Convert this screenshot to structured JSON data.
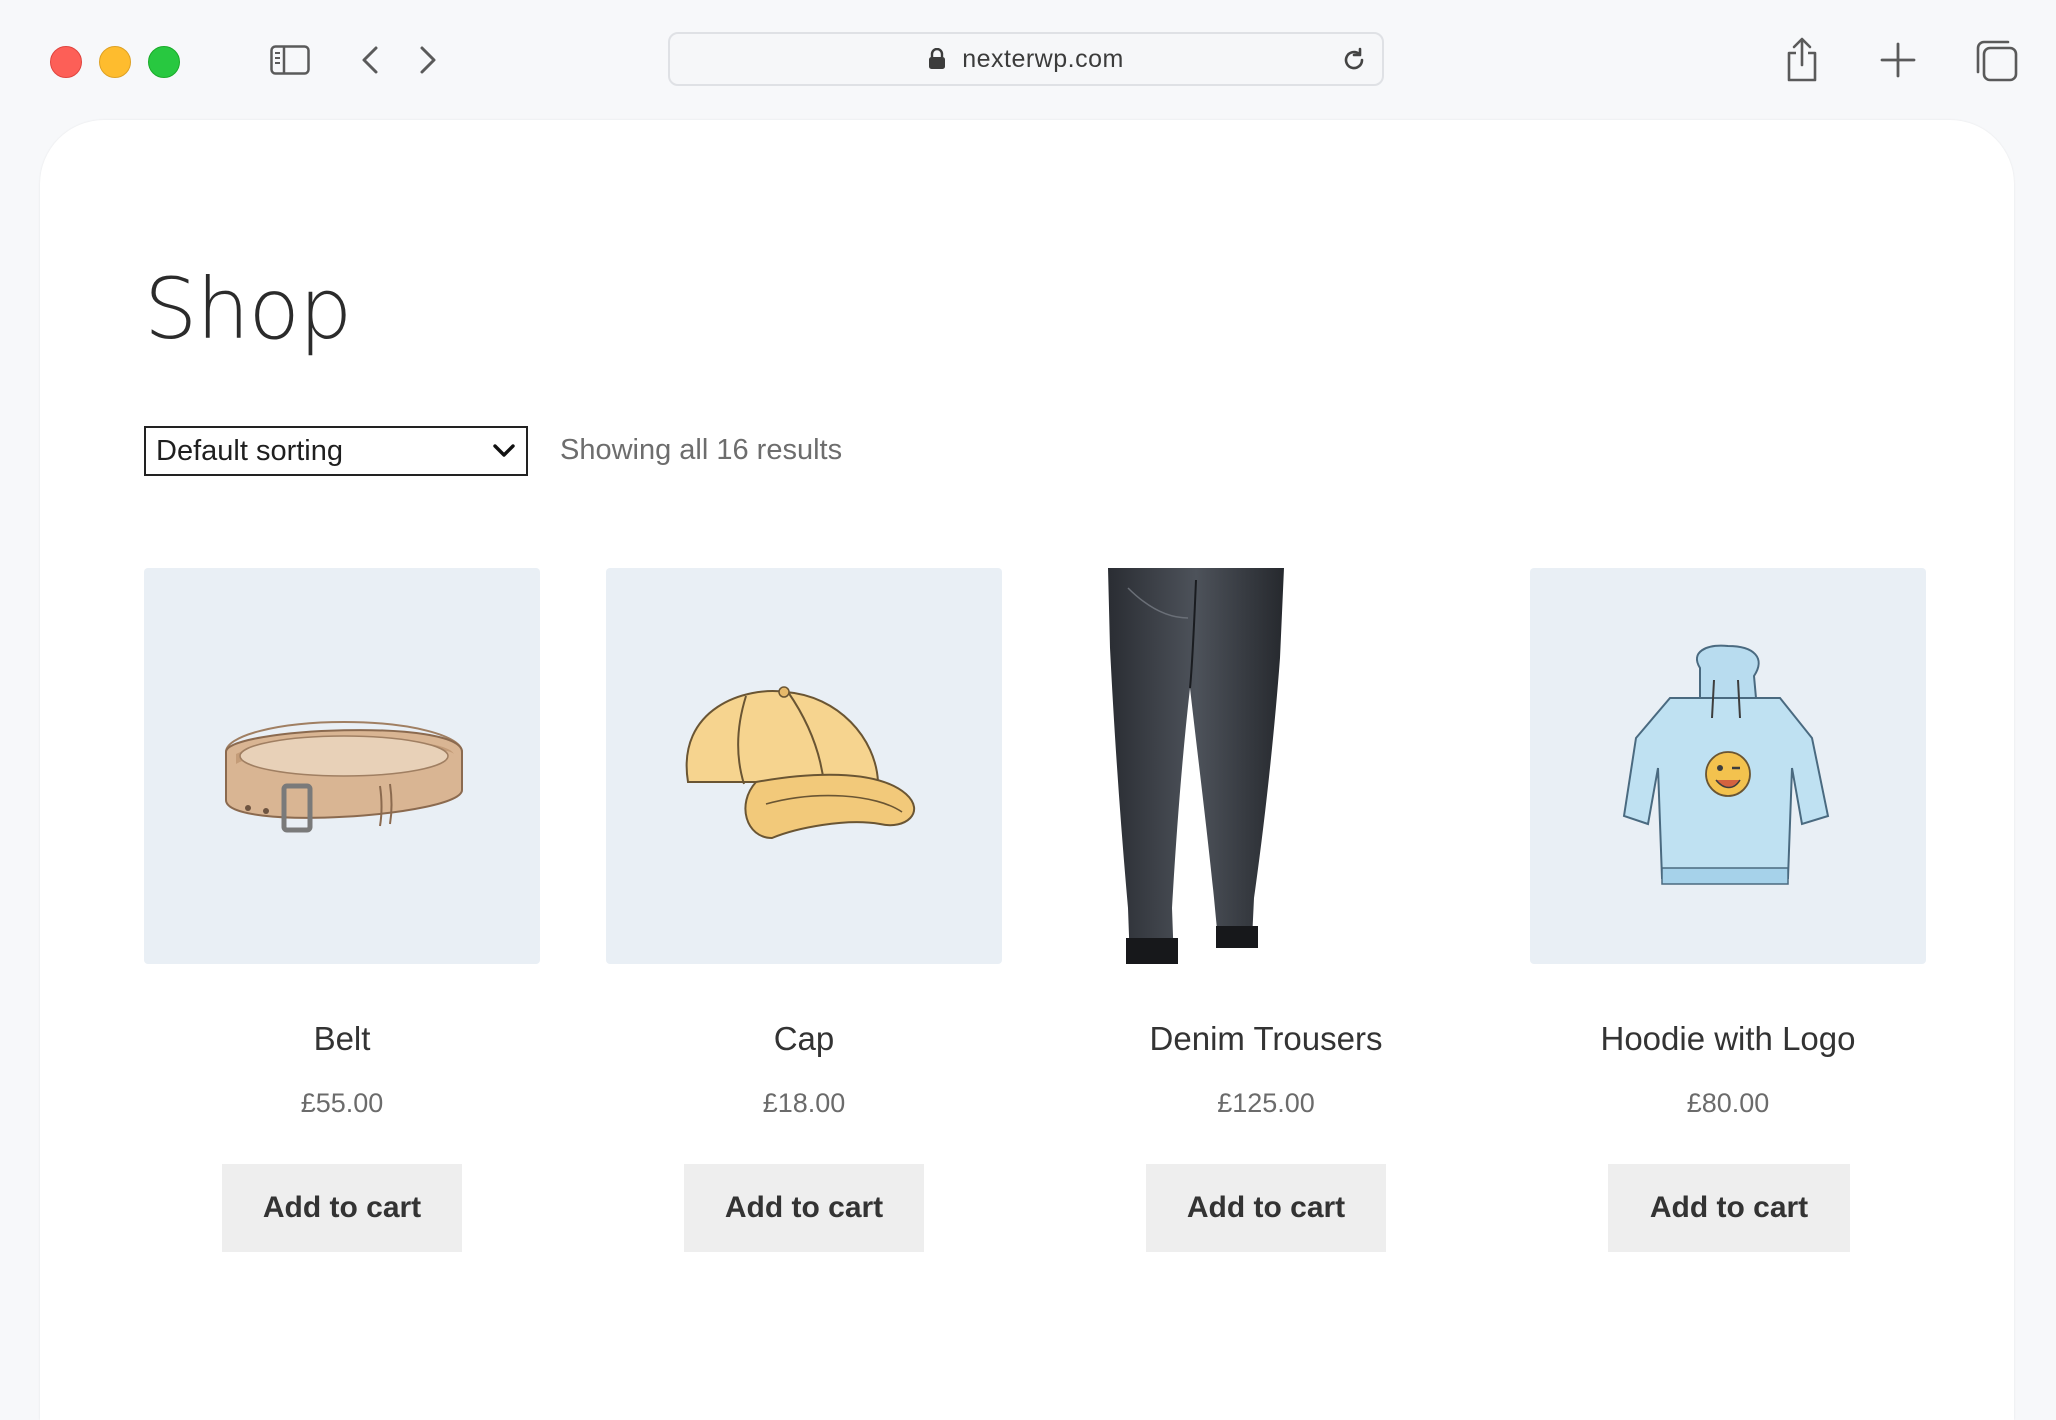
{
  "browser": {
    "url": "nexterwp.com"
  },
  "page": {
    "title": "Shop",
    "sorting": {
      "selected": "Default sorting"
    },
    "results_text": "Showing all 16 results"
  },
  "products": [
    {
      "name": "Belt",
      "price": "£55.00",
      "button": "Add to cart",
      "image_icon": "belt-image"
    },
    {
      "name": "Cap",
      "price": "£18.00",
      "button": "Add to cart",
      "image_icon": "cap-image"
    },
    {
      "name": "Denim Trousers",
      "price": "£125.00",
      "button": "Add to cart",
      "image_icon": "jeans-image"
    },
    {
      "name": "Hoodie with Logo",
      "price": "£80.00",
      "button": "Add to cart",
      "image_icon": "hoodie-image"
    }
  ],
  "colors": {
    "traffic_red": "#fd5f57",
    "traffic_yellow": "#febc2e",
    "traffic_green": "#28c840",
    "image_bg": "#e9eff5",
    "button_bg": "#eeeeee"
  }
}
